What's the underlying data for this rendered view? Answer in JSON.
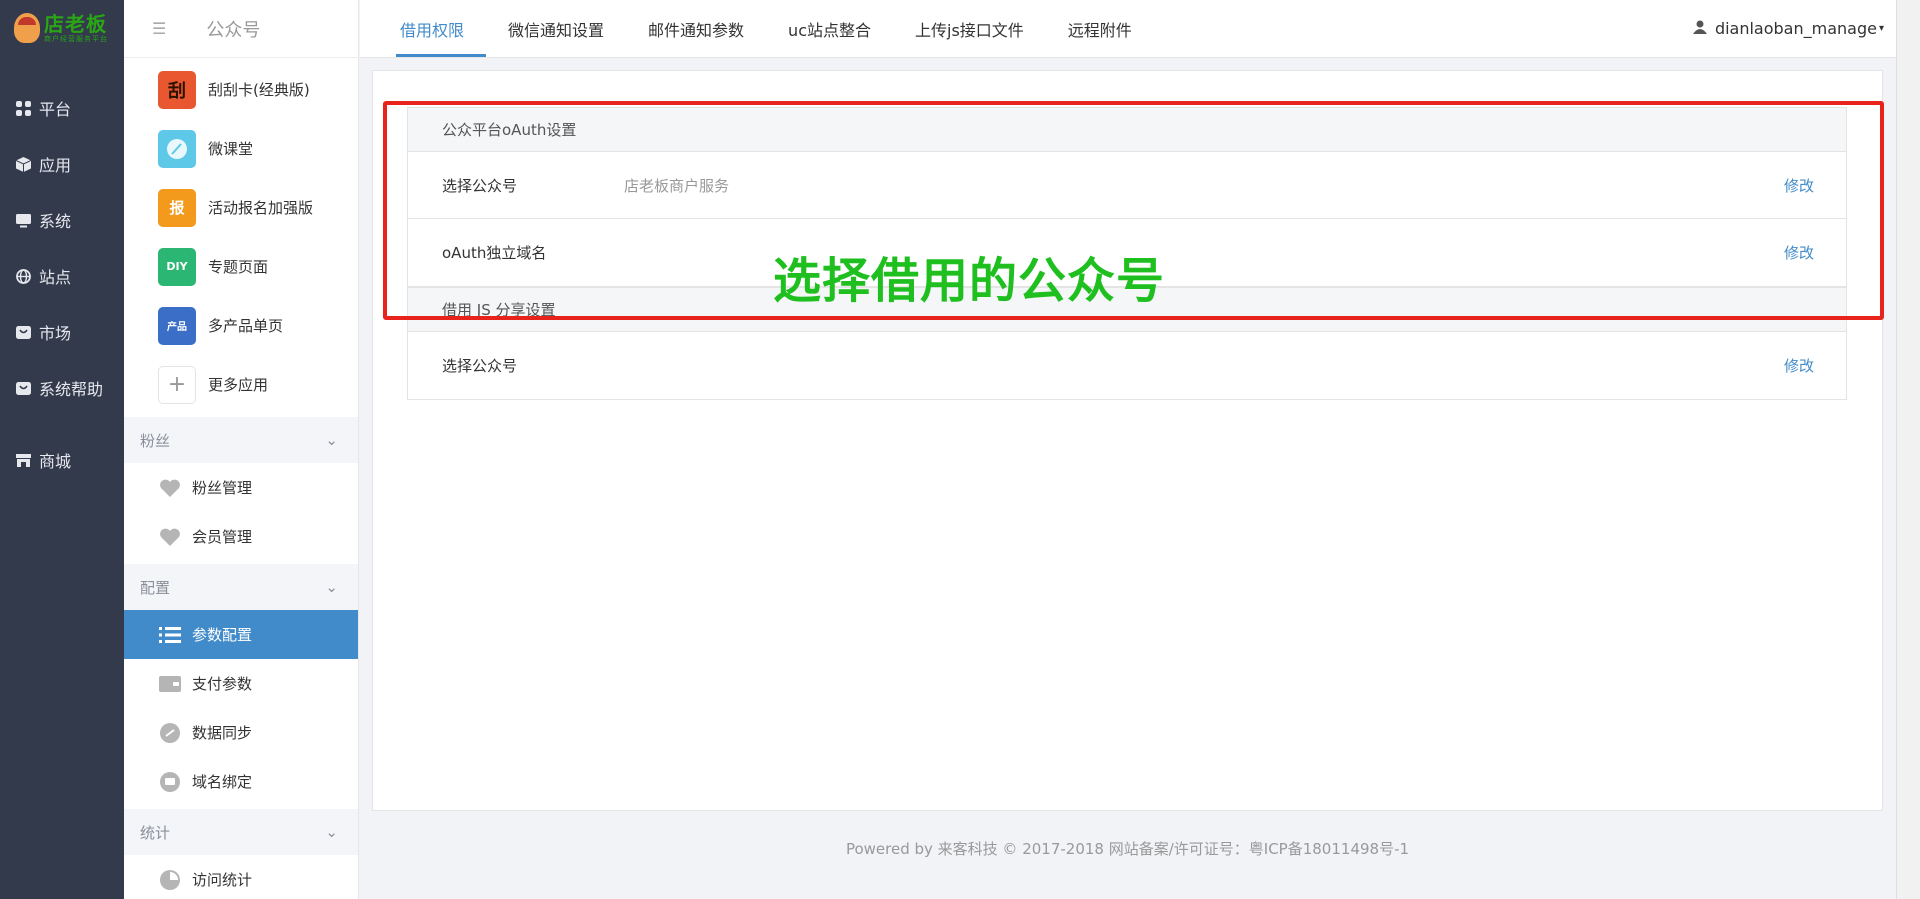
{
  "rail": {
    "logo_text": "店老板",
    "logo_sub": "商户经营服务平台",
    "items": [
      {
        "label": "平台",
        "icon": "grid-icon"
      },
      {
        "label": "应用",
        "icon": "cube-icon"
      },
      {
        "label": "系统",
        "icon": "monitor-icon"
      },
      {
        "label": "站点",
        "icon": "globe-icon"
      },
      {
        "label": "市场",
        "icon": "bag-icon"
      },
      {
        "label": "系统帮助",
        "icon": "bag-icon"
      },
      {
        "label": "商城",
        "icon": "store-icon"
      }
    ]
  },
  "side": {
    "title": "公众号",
    "apps": [
      {
        "label": "刮刮卡(经典版)",
        "icon_text": "刮",
        "color": "#e8572f"
      },
      {
        "label": "微课堂",
        "icon_text": "",
        "color": "#5ec8e8"
      },
      {
        "label": "活动报名加强版",
        "icon_text": "报",
        "color": "#f39a1c"
      },
      {
        "label": "专题页面",
        "icon_text": "DIY",
        "color": "#2bb673"
      },
      {
        "label": "多产品单页",
        "icon_text": "产品",
        "color": "#3b6fc7"
      },
      {
        "label": "更多应用",
        "icon_text": "+",
        "color": "#ffffff"
      }
    ],
    "section_fans": "粉丝",
    "fans_items": [
      "粉丝管理",
      "会员管理"
    ],
    "section_config": "配置",
    "config_items": [
      "参数配置",
      "支付参数",
      "数据同步",
      "域名绑定"
    ],
    "section_stats": "统计",
    "stats_items": [
      "访问统计"
    ]
  },
  "topbar": {
    "tabs": [
      "借用权限",
      "微信通知设置",
      "邮件通知参数",
      "uc站点整合",
      "上传js接口文件",
      "远程附件"
    ],
    "user": "dianlaoban_manage"
  },
  "panels": {
    "oauth": {
      "title": "公众平台oAuth设置",
      "row1_label": "选择公众号",
      "row1_value": "店老板商户服务",
      "row2_label": "oAuth独立域名",
      "edit": "修改"
    },
    "js": {
      "title": "借用 JS 分享设置",
      "row1_label": "选择公众号",
      "edit": "修改"
    }
  },
  "annotation": "选择借用的公众号",
  "footer": "Powered by 来客科技 © 2017-2018 网站备案/许可证号：粤ICP备18011498号-1",
  "colors": {
    "accent": "#428bca",
    "rail": "#323a4c",
    "annot_box": "#e8231b",
    "annot_text": "#1fbf1f"
  }
}
